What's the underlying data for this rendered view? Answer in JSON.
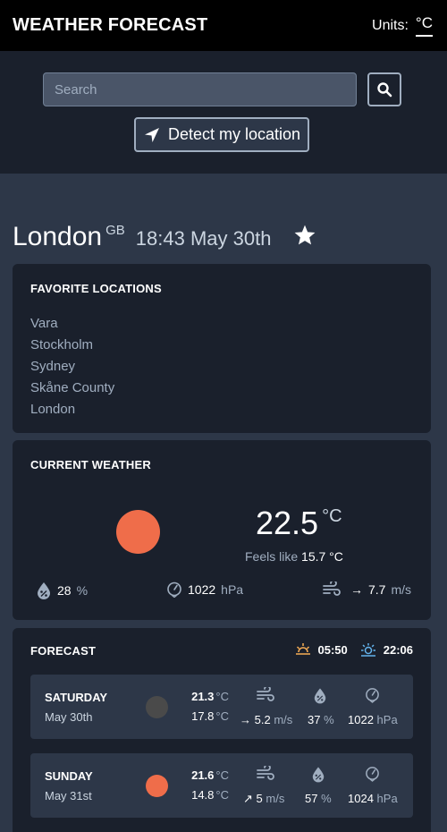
{
  "header": {
    "title": "WEATHER FORECAST",
    "units_label": "Units:",
    "units_value": "°C"
  },
  "search": {
    "placeholder": "Search",
    "detect_label": "Detect my location"
  },
  "location": {
    "city": "London",
    "country": "GB",
    "datetime": "18:43 May 30th"
  },
  "favorites": {
    "title": "FAVORITE LOCATIONS",
    "items": [
      "Vara",
      "Stockholm",
      "Sydney",
      "Skåne County",
      "London"
    ]
  },
  "current": {
    "title": "CURRENT WEATHER",
    "temp": "22.5",
    "temp_unit": "°C",
    "feels_label": "Feels like",
    "feels_value": "15.7 °C",
    "humidity": "28",
    "humidity_unit": "%",
    "pressure": "1022",
    "pressure_unit": "hPa",
    "wind_arrow": "→",
    "wind": "7.7",
    "wind_unit": "m/s"
  },
  "forecast": {
    "title": "FORECAST",
    "sunrise": "05:50",
    "sunset": "22:06",
    "days": [
      {
        "name": "SATURDAY",
        "date": "May 30th",
        "high": "21.3",
        "low": "17.8",
        "unit": "°C",
        "wind_arrow": "→",
        "wind": "5.2",
        "wind_unit": "m/s",
        "humidity": "37",
        "humidity_unit": "%",
        "pressure": "1022",
        "pressure_unit": "hPa",
        "icon_color": "#4a4a4a"
      },
      {
        "name": "SUNDAY",
        "date": "May 31st",
        "high": "21.6",
        "low": "14.8",
        "unit": "°C",
        "wind_arrow": "↗",
        "wind": "5",
        "wind_unit": "m/s",
        "humidity": "57",
        "humidity_unit": "%",
        "pressure": "1024",
        "pressure_unit": "hPa",
        "icon_color": "#ef6d4a"
      }
    ]
  },
  "colors": {
    "accent_sun": "#ef6d4a",
    "panel": "#1a202c",
    "background": "#2d3748",
    "sunrise_icon": "#f6ad55",
    "sunset_icon": "#63b3ed"
  },
  "icons": [
    "search-icon",
    "location-arrow-icon",
    "star-icon",
    "humidity-icon",
    "pressure-icon",
    "wind-icon",
    "sunrise-icon",
    "sunset-icon"
  ]
}
